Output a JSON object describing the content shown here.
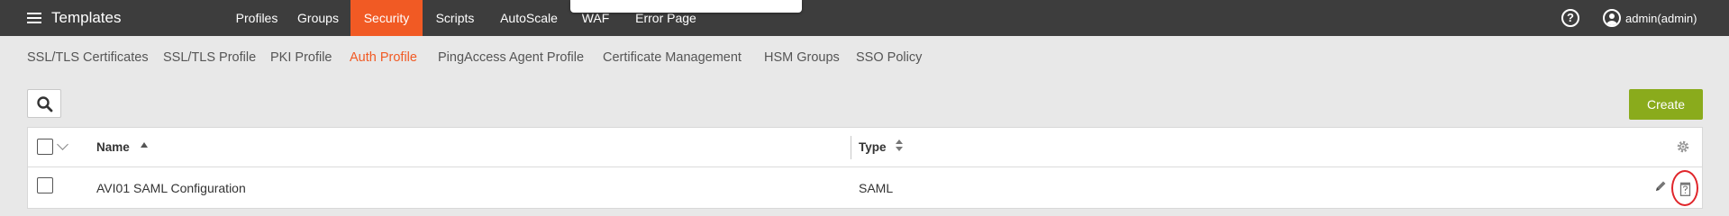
{
  "app": {
    "title": "Templates"
  },
  "main_nav": [
    {
      "id": "profiles",
      "label": "Profiles",
      "active": false
    },
    {
      "id": "groups",
      "label": "Groups",
      "active": false
    },
    {
      "id": "security",
      "label": "Security",
      "active": true
    },
    {
      "id": "scripts",
      "label": "Scripts",
      "active": false
    },
    {
      "id": "autoscale",
      "label": "AutoScale",
      "active": false
    },
    {
      "id": "waf",
      "label": "WAF",
      "active": false
    },
    {
      "id": "error-page",
      "label": "Error Page",
      "active": false
    }
  ],
  "header": {
    "help_symbol": "?",
    "user": "admin(admin)"
  },
  "sub_nav": [
    {
      "id": "ssl-tls-certificates",
      "label": "SSL/TLS Certificates",
      "active": false
    },
    {
      "id": "ssl-tls-profile",
      "label": "SSL/TLS Profile",
      "active": false
    },
    {
      "id": "pki-profile",
      "label": "PKI Profile",
      "active": false
    },
    {
      "id": "auth-profile",
      "label": "Auth Profile",
      "active": true
    },
    {
      "id": "pingaccess-agent-profile",
      "label": "PingAccess Agent Profile",
      "active": false
    },
    {
      "id": "certificate-management",
      "label": "Certificate Management",
      "active": false
    },
    {
      "id": "hsm-groups",
      "label": "HSM Groups",
      "active": false
    },
    {
      "id": "sso-policy",
      "label": "SSO Policy",
      "active": false
    }
  ],
  "toolbar": {
    "create_label": "Create"
  },
  "table": {
    "columns": [
      {
        "id": "name",
        "label": "Name",
        "sort": "ascending"
      },
      {
        "id": "type",
        "label": "Type",
        "sort": "sortable"
      }
    ],
    "rows": [
      {
        "name": "AVI01 SAML Configuration",
        "type": "SAML"
      }
    ]
  },
  "colors": {
    "accent": "#f15a24",
    "topbar": "#3d3d3d",
    "create": "#8aab1c",
    "highlight_ring": "#e0262b"
  },
  "icons": [
    "menu-icon",
    "help-icon",
    "user-icon",
    "search-icon",
    "chevron-down-icon",
    "sort-up-icon",
    "sort-icon",
    "gear-icon",
    "pencil-icon",
    "delete-icon"
  ]
}
